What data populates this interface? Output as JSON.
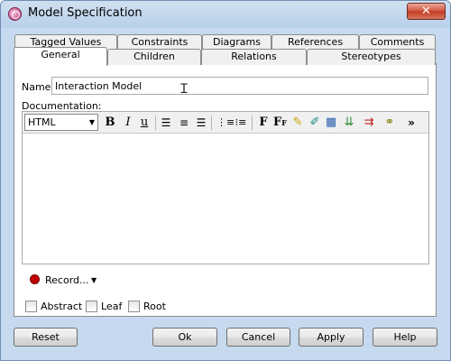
{
  "window": {
    "title": "Model Specification",
    "close_glyph": "✕"
  },
  "tabs": {
    "row1": [
      "Tagged Values",
      "Constraints",
      "Diagrams",
      "References",
      "Comments"
    ],
    "row2": [
      "General",
      "Children",
      "Relations",
      "Stereotypes"
    ]
  },
  "general": {
    "name_label": "Name:",
    "name_value": "Interaction Model",
    "documentation_label": "Documentation:",
    "format_value": "HTML",
    "toolbar_icons": [
      "bold-icon",
      "italic-icon",
      "underline-icon",
      "align-left-icon",
      "align-center-icon",
      "align-right-icon",
      "numbered-list-icon",
      "bullet-list-icon",
      "font-icon",
      "font-size-icon",
      "highlight-icon",
      "text-color-icon",
      "table-icon",
      "insert-row-icon",
      "delete-row-icon",
      "link-icon",
      "more-icon"
    ],
    "record_label": "Record...",
    "checkboxes": [
      "Abstract",
      "Leaf",
      "Root"
    ]
  },
  "buttons": {
    "reset": "Reset",
    "ok": "Ok",
    "cancel": "Cancel",
    "apply": "Apply",
    "help": "Help"
  },
  "colors": {
    "title_bar": "#b9d0ea",
    "close_button": "#c03b22",
    "record_dot": "#c00000"
  }
}
